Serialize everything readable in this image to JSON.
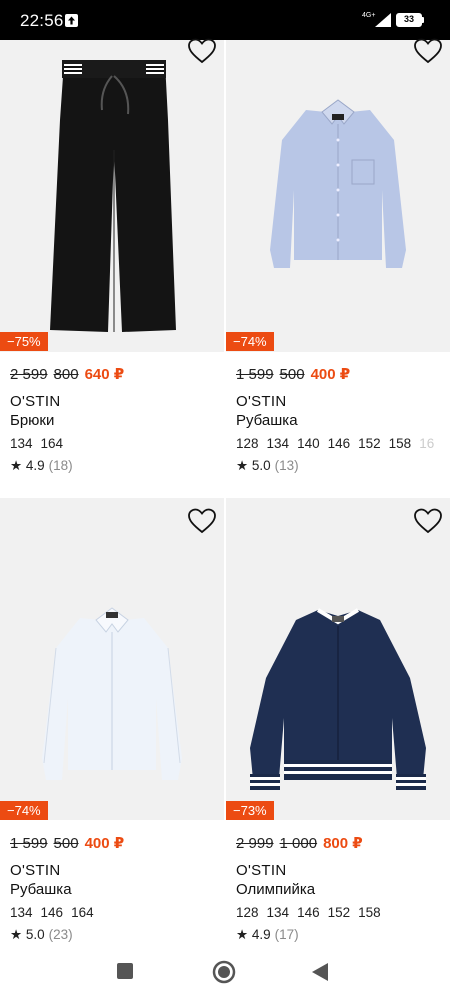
{
  "status": {
    "time": "22:56",
    "network": "4G+",
    "battery": "33"
  },
  "products": [
    {
      "discount": "−75%",
      "old_price": "2 599",
      "mid_price": "800",
      "price": "640 ₽",
      "brand": "O'STIN",
      "title": "Брюки",
      "sizes": [
        "134",
        "164"
      ],
      "rating": "★ 4.9",
      "reviews": "(18)"
    },
    {
      "discount": "−74%",
      "old_price": "1 599",
      "mid_price": "500",
      "price": "400 ₽",
      "brand": "O'STIN",
      "title": "Рубашка",
      "sizes": [
        "128",
        "134",
        "140",
        "146",
        "152",
        "158",
        "16"
      ],
      "rating": "★ 5.0",
      "reviews": "(13)"
    },
    {
      "discount": "−74%",
      "old_price": "1 599",
      "mid_price": "500",
      "price": "400 ₽",
      "brand": "O'STIN",
      "title": "Рубашка",
      "sizes": [
        "134",
        "146",
        "164"
      ],
      "rating": "★ 5.0",
      "reviews": "(23)"
    },
    {
      "discount": "−73%",
      "old_price": "2 999",
      "mid_price": "1 000",
      "price": "800 ₽",
      "brand": "O'STIN",
      "title": "Олимпийка",
      "sizes": [
        "128",
        "134",
        "146",
        "152",
        "158"
      ],
      "rating": "★ 4.9",
      "reviews": "(17)"
    }
  ],
  "icons": {
    "favorite": "heart-outline-icon",
    "nav_recents": "square-icon",
    "nav_home": "circle-icon",
    "nav_back": "triangle-back-icon"
  },
  "colors": {
    "accent": "#ec4b12",
    "text": "#111111",
    "muted": "#8a8a8a"
  }
}
